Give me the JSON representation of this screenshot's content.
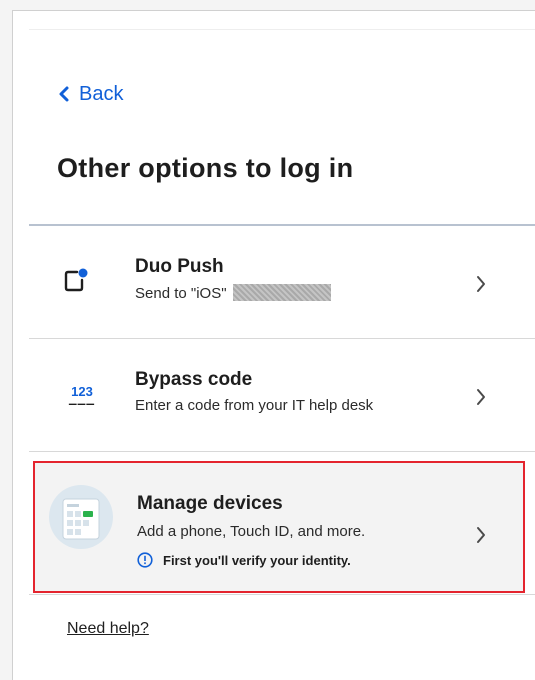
{
  "header": {
    "back_label": "Back",
    "title": "Other options to log in"
  },
  "options": [
    {
      "title": "Duo Push",
      "subtitle": "Send to \"iOS\"",
      "icon": "phone-push-icon"
    },
    {
      "title": "Bypass code",
      "subtitle": "Enter a code from your IT help desk",
      "icon": "code-icon",
      "icon_text": "123"
    },
    {
      "title": "Manage devices",
      "subtitle": "Add a phone, Touch ID, and more.",
      "notice": "First you'll verify your identity.",
      "icon": "device-management-illustration",
      "highlight_color": "#e4242e"
    }
  ],
  "footer": {
    "help_label": "Need help?"
  },
  "colors": {
    "accent": "#1160d8",
    "highlight": "#e4242e",
    "text": "#1e1e1e"
  }
}
